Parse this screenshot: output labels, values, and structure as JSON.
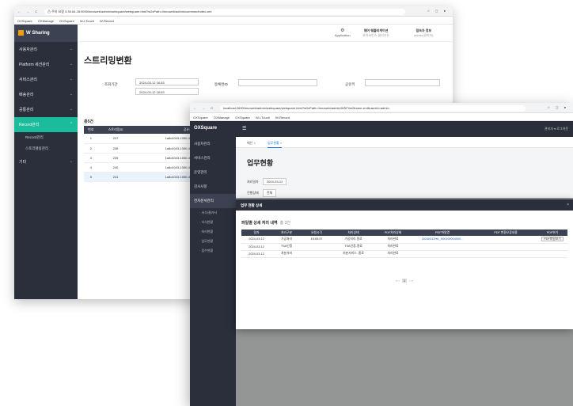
{
  "winA": {
    "chrome": {
      "nav": "← → C",
      "url": "⚠ 주의 요함  3.35.64.28:9090/innoweb/admin/webquare/webquare.html?w2xPath=/innoweb/admin/common/index.xml",
      "right": "☆ ◻ ●"
    },
    "bookmarks": [
      "OXSquare",
      "OXManage",
      "OXSquare",
      "W-i-Touch",
      "W-Record"
    ],
    "brand": "W Sharing",
    "sidebar": [
      {
        "label": "사용자관리",
        "chev": "⌄"
      },
      {
        "label": "Platform 세션관리",
        "chev": "⌄"
      },
      {
        "label": "서비스관리",
        "chev": "⌄"
      },
      {
        "label": "배송관리",
        "chev": "⌄"
      },
      {
        "label": "공통관리",
        "chev": "⌄"
      },
      {
        "label": "Record관리",
        "chev": "⌃"
      }
    ],
    "sub_items": [
      "Record관리",
      "스토리텔링관리"
    ],
    "last_item": {
      "label": "기타",
      "chev": "⌄"
    },
    "topbar": {
      "gear": "⚙",
      "gear_label": "Application",
      "grp1_title": "웨어 웨플러케이션",
      "grp1_sub": "코어코인스 클라우드",
      "grp2_title": "접속자 정보",
      "grp2_sub": "admin(관리자)"
    },
    "page_title": "스트리밍변환",
    "form": {
      "period_label": "조회기간",
      "date_from": "2024-03-12 16:53",
      "date_to": "2024-03-12 18:53",
      "user_label": "등록번ID",
      "kwd_label": "공유키"
    },
    "count": "총5건",
    "table": {
      "headers": [
        "번호",
        "스트리밍ID",
        "공유키"
      ],
      "rows": [
        [
          "1",
          "237",
          "1a8c4043-1050-4584-b798-a4..."
        ],
        [
          "2",
          "238",
          "1a8c4043-1050-4584-b798-a4..."
        ],
        [
          "3",
          "239",
          "1a8c4043-1050-4584-b798-a4..."
        ],
        [
          "4",
          "240",
          "1a8c4043-1050-4584-b798-a4..."
        ],
        [
          "5",
          "241",
          "1a8c4043-1050-4584-b798-a4..."
        ]
      ]
    }
  },
  "winB": {
    "chrome": {
      "nav": "← → C",
      "url": "localhost:2690/innoweb/admin/webquare/webquare.html?w2xPath=/innoweb/admin/WSFI/w2frame.xml&userId=admin",
      "right": "☆ ◻ ●"
    },
    "bookmarks": [
      "OXSquare",
      "OXManage",
      "OXSquare",
      "W-i-Touch",
      "W-Record"
    ],
    "brand": "OXSquare",
    "sidebar": [
      "사용자관리",
      "서비스관리",
      "운영관리",
      "감사사항"
    ],
    "active_item": "전자문서관리",
    "sub_items": [
      "· 서식/결과서",
      "· 서식현황",
      "· 처리현황",
      "· 업무현황",
      "· 접수현황"
    ],
    "topbar": {
      "menu": "☰",
      "user": "관리자 ▾  로그아웃"
    },
    "tabs": [
      "메인 ×",
      "업무현황 ×"
    ],
    "page_title": "업무현황",
    "filter": {
      "label1": "처리일자",
      "value1": "2024-03-12",
      "label2": "진행상태",
      "value2": "전체"
    },
    "bottom_pager": "« ‹ 1 › »",
    "modal": {
      "title": "업무 현황 상세",
      "close": "×",
      "subtitle": "파일별 상세 처리 내역",
      "count": "총 3건",
      "headers": [
        "일자",
        "처리구분",
        "요청시각",
        "처리상태",
        "PDF처리상태",
        "PDF파일명",
        "PDF 변환오류내용",
        "PDF보기"
      ],
      "rows": [
        [
          "2024-03-12",
          "가공처리",
          "15:05:37",
          "가공처리-종료",
          "처리완료",
          "20240312HK_000100004000...",
          "",
          "PDF파일보기"
        ],
        [
          "2024-03-12",
          "TSA인증",
          "",
          "TSA인증-종료",
          "처리완료",
          "",
          "",
          ""
        ],
        [
          "2024-03-12",
          "처분서비",
          "",
          "처분서비스 -종료",
          "처리완료",
          "",
          "",
          ""
        ]
      ],
      "pager": {
        "prev": "« ‹",
        "current": "1",
        "next": "› »"
      }
    }
  }
}
